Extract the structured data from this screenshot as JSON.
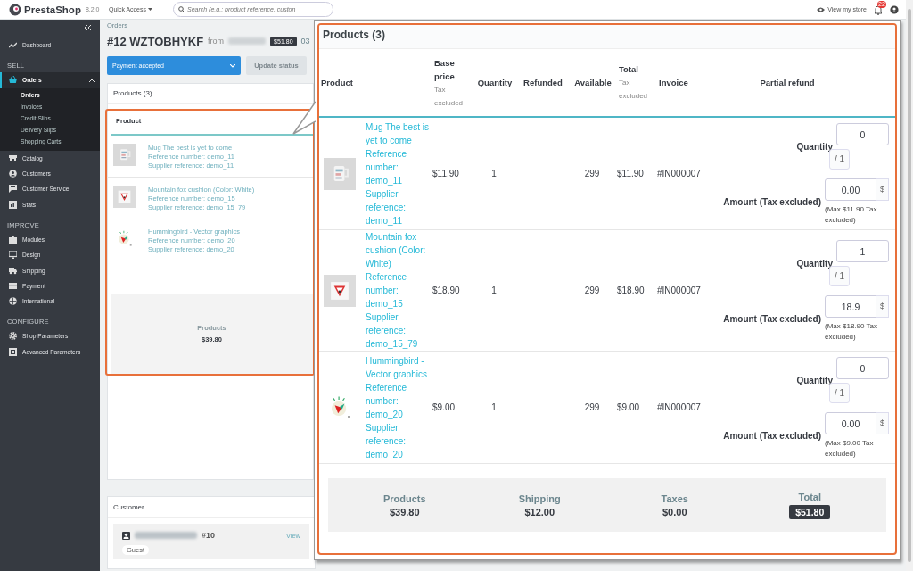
{
  "header": {
    "logo": "PrestaShop",
    "version": "8.2.0",
    "quick_access": "Quick Access",
    "search": {
      "placeholder": "Search (e.g.: product reference, custon"
    },
    "view_store": "View my store",
    "notifications": "22"
  },
  "sidebar": {
    "sections": [
      {
        "items": [
          {
            "label": "Dashboard",
            "selected": false
          }
        ]
      },
      {
        "title": "SELL",
        "items": [
          {
            "label": "Orders",
            "selected": true,
            "expanded": true,
            "children": [
              {
                "label": "Orders",
                "selected": true
              },
              {
                "label": "Invoices",
                "selected": false
              },
              {
                "label": "Credit Slips",
                "selected": false
              },
              {
                "label": "Delivery Slips",
                "selected": false
              },
              {
                "label": "Shopping Carts",
                "selected": false
              }
            ]
          },
          {
            "label": "Catalog",
            "selected": false
          },
          {
            "label": "Customers",
            "selected": false
          },
          {
            "label": "Customer Service",
            "selected": false
          },
          {
            "label": "Stats",
            "selected": false
          }
        ]
      },
      {
        "title": "IMPROVE",
        "items": [
          {
            "label": "Modules",
            "selected": false
          },
          {
            "label": "Design",
            "selected": false
          },
          {
            "label": "Shipping",
            "selected": false
          },
          {
            "label": "Payment",
            "selected": false
          },
          {
            "label": "International",
            "selected": false
          }
        ]
      },
      {
        "title": "CONFIGURE",
        "items": [
          {
            "label": "Shop Parameters",
            "selected": false
          },
          {
            "label": "Advanced Parameters",
            "selected": false
          }
        ]
      }
    ]
  },
  "order": {
    "breadcrumb": "Orders",
    "number": "#12",
    "reference": "WZTOBHYKF",
    "from": "from",
    "total": "$51.80",
    "date": "03"
  },
  "status": {
    "value": "Payment accepted",
    "button": "Update status",
    "button_disabled": true
  },
  "products_card": {
    "title": "Products (3)",
    "column": "Product",
    "rows": [
      {
        "name": "Mug The best is yet to come",
        "reference": "Reference number: demo_11",
        "supplier": "Supplier reference: demo_11"
      },
      {
        "name": "Mountain fox cushion (Color: White)",
        "reference": "Reference number: demo_15",
        "supplier": "Supplier reference: demo_15_79"
      },
      {
        "name": "Hummingbird - Vector graphics",
        "reference": "Reference number: demo_20",
        "supplier": "Supplier reference: demo_20"
      }
    ],
    "summary": {
      "label": "Products",
      "value": "$39.80"
    }
  },
  "callout": {
    "title": "Products (3)",
    "columns": [
      {
        "label": "Product"
      },
      {
        "label": "Base price",
        "note": "Tax excluded"
      },
      {
        "label": "Quantity"
      },
      {
        "label": "Refunded"
      },
      {
        "label": "Available"
      },
      {
        "label": "Total",
        "note": "Tax excluded"
      },
      {
        "label": "Invoice"
      },
      {
        "label": "Partial refund"
      }
    ],
    "rows": [
      {
        "name": "Mug The best is yet to come",
        "reference": "Reference number: demo_11",
        "supplier": "Supplier reference: demo_11",
        "base_price": "$11.90",
        "quantity": "1",
        "available": "299",
        "total": "$11.90",
        "invoice": "#IN000007",
        "refund": {
          "quantity_label": "Quantity",
          "quantity": "0",
          "max_quantity": "/ 1",
          "amount_label": "Amount (Tax excluded)",
          "amount": "0.00",
          "currency": "$",
          "note": "(Max $11.90 Tax excluded)"
        }
      },
      {
        "name": "Mountain fox cushion (Color: White)",
        "reference": "Reference number: demo_15",
        "supplier": "Supplier reference: demo_15_79",
        "base_price": "$18.90",
        "quantity": "1",
        "available": "299",
        "total": "$18.90",
        "invoice": "#IN000007",
        "refund": {
          "quantity_label": "Quantity",
          "quantity": "1",
          "max_quantity": "/ 1",
          "amount_label": "Amount (Tax excluded)",
          "amount": "18.9",
          "currency": "$",
          "note": "(Max $18.90 Tax excluded)"
        }
      },
      {
        "name": "Hummingbird - Vector graphics",
        "reference": "Reference number: demo_20",
        "supplier": "Supplier reference: demo_20",
        "base_price": "$9.00",
        "quantity": "1",
        "available": "299",
        "total": "$9.00",
        "invoice": "#IN000007",
        "refund": {
          "quantity_label": "Quantity",
          "quantity": "0",
          "max_quantity": "/ 1",
          "amount_label": "Amount (Tax excluded)",
          "amount": "0.00",
          "currency": "$",
          "note": "(Max $9.00 Tax excluded)"
        }
      }
    ],
    "summary": [
      {
        "kind": "amount",
        "label": "Products",
        "value": "$39.80"
      },
      {
        "kind": "amount",
        "label": "Shipping",
        "value": "$12.00"
      },
      {
        "kind": "amount",
        "label": "Taxes",
        "value": "$0.00"
      },
      {
        "kind": "badge",
        "label": "Total",
        "value": "$51.80"
      }
    ]
  },
  "customer": {
    "title": "Customer",
    "number": "#10",
    "view": "View",
    "badge": "Guest"
  }
}
